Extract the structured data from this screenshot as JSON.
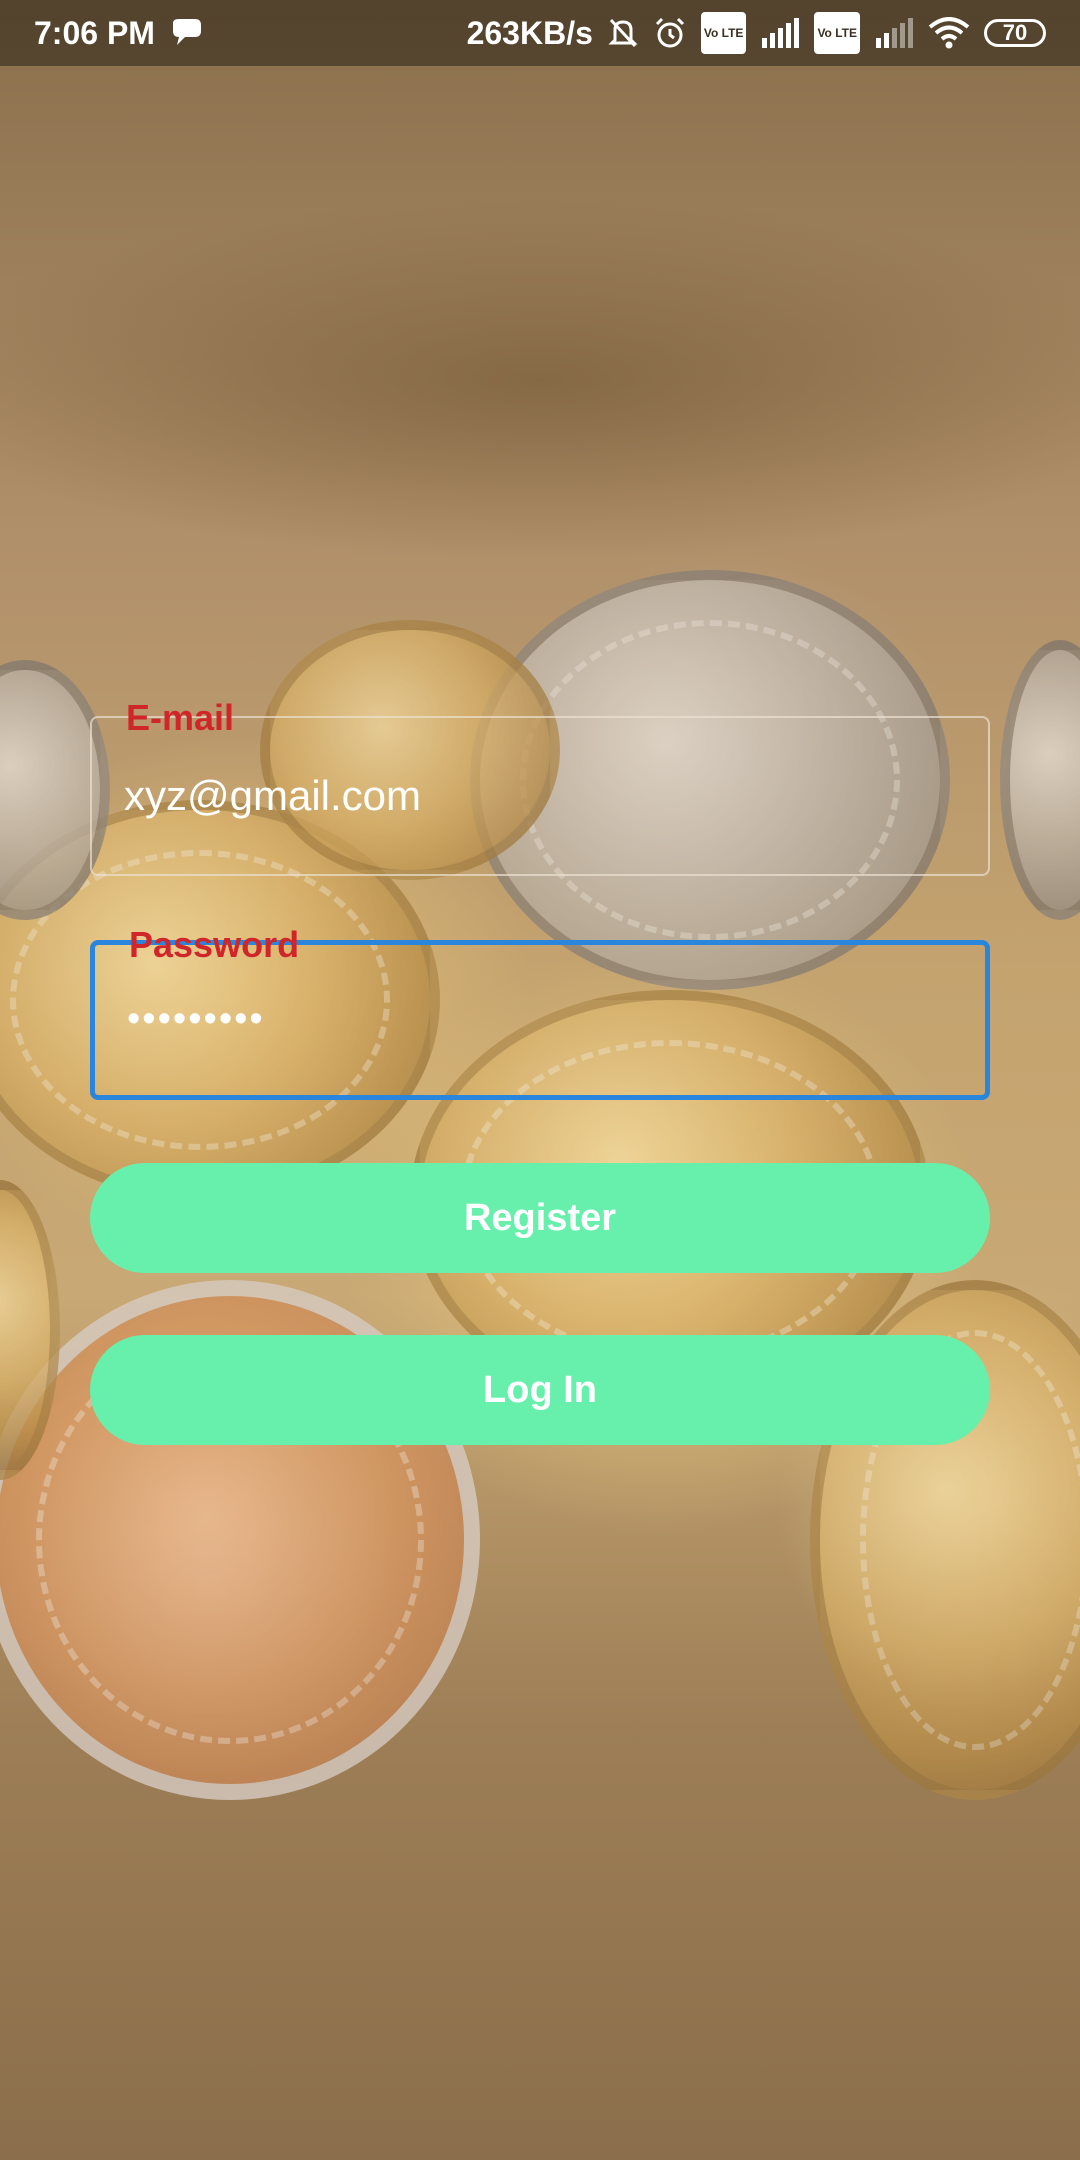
{
  "status_bar": {
    "time": "7:06 PM",
    "net_speed": "263KB/s",
    "volte_1": "Vo LTE",
    "volte_2": "Vo LTE",
    "battery": "70",
    "icons": [
      "chat-bubble-icon",
      "bell-off-icon",
      "alarm-icon",
      "signal-icon",
      "wifi-icon",
      "battery-icon"
    ]
  },
  "form": {
    "email": {
      "label": "E-mail",
      "value": "xyz@gmail.com"
    },
    "password": {
      "label": "Password",
      "value": "•••••••••"
    }
  },
  "buttons": {
    "register": "Register",
    "login": "Log In"
  },
  "colors": {
    "accent_button": "#66f0ac",
    "label_red": "#d0262a",
    "focus_blue": "#2a86dd"
  }
}
